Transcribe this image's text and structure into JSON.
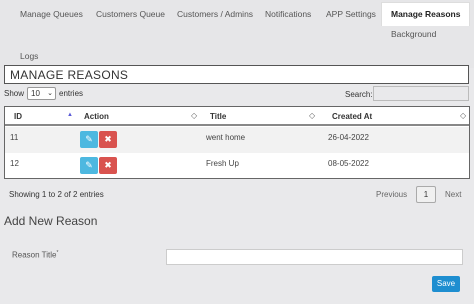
{
  "tabs": [
    "Manage Queues",
    "Customers Queue",
    "Customers / Admins",
    "Notifications",
    "APP Settings",
    "Manage Reasons",
    "Background",
    "Logs"
  ],
  "page_title": "MANAGE REASONS",
  "length": {
    "show": "Show",
    "value": "10",
    "entries": "entries"
  },
  "search": {
    "label": "Search:",
    "placeholder": ""
  },
  "table": {
    "headers": [
      "ID",
      "Action",
      "Title",
      "Created At"
    ],
    "rows": [
      {
        "id": "11",
        "title": "went home",
        "created": "26-04-2022"
      },
      {
        "id": "12",
        "title": "Fresh Up",
        "created": "08-05-2022"
      }
    ]
  },
  "info": "Showing 1 to 2 of 2 entries",
  "pagination": {
    "previous": "Previous",
    "page": "1",
    "next": "Next"
  },
  "form": {
    "title": "Add New Reason",
    "field_label": "Reason Title",
    "required_mark": "*",
    "field_value": "",
    "save": "Save"
  },
  "colors": {
    "edit": "#4db8e0",
    "delete": "#d9534f",
    "save": "#1e8ed0"
  },
  "icons": {
    "edit": "pencil-icon",
    "delete": "x-icon"
  }
}
